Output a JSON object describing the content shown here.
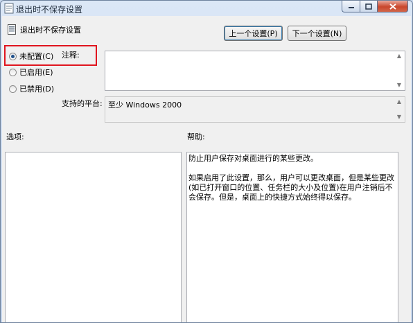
{
  "window": {
    "title": "退出时不保存设置"
  },
  "header": {
    "policy_name": "退出时不保存设置"
  },
  "buttons": {
    "prev_setting": "上一个设置(P)",
    "next_setting": "下一个设置(N)"
  },
  "state_options": [
    {
      "label": "未配置(C)",
      "selected": true
    },
    {
      "label": "已启用(E)",
      "selected": false
    },
    {
      "label": "已禁用(D)",
      "selected": false
    }
  ],
  "comment": {
    "label": "注释:",
    "value": ""
  },
  "platform": {
    "label": "支持的平台:",
    "value": "至少 Windows 2000"
  },
  "options": {
    "label": "选项:"
  },
  "help": {
    "label": "帮助:",
    "paragraphs": [
      "防止用户保存对桌面进行的某些更改。",
      "如果启用了此设置，那么，用户可以更改桌面，但是某些更改(如已打开窗口的位置、任务栏的大小及位置)在用户注销后不会保存。但是，桌面上的快捷方式始终得以保存。"
    ]
  },
  "colors": {
    "highlight": "#e0141e",
    "close_button": "#c9462c"
  }
}
